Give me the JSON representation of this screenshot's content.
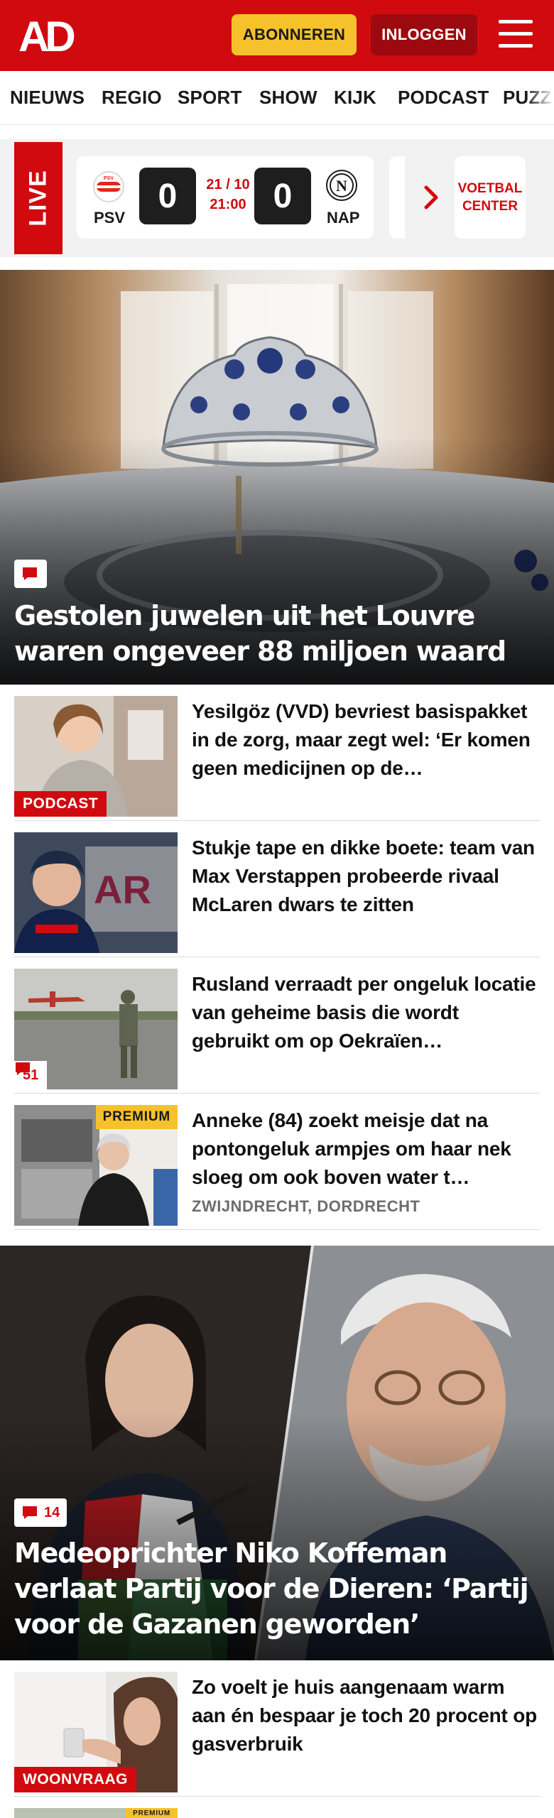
{
  "header": {
    "logo_text": "AD",
    "subscribe_label": "ABONNEREN",
    "login_label": "INLOGGEN",
    "brand_color": "#d10a10"
  },
  "nav": {
    "items": [
      "NIEUWS",
      "REGIO",
      "SPORT",
      "SHOW",
      "KIJK",
      "PODCAST",
      "PUZZ"
    ]
  },
  "live": {
    "label": "LIVE",
    "match": {
      "home": "PSV",
      "away": "NAP",
      "home_score": "0",
      "away_score": "0",
      "date": "21 / 10",
      "time": "21:00"
    },
    "voetbal_line1": "VOETBAL",
    "voetbal_line2": "CENTER"
  },
  "hero1": {
    "title": "Gestolen juwelen uit het Louvre waren ongeveer 88 miljoen waard",
    "icon": "comment-icon"
  },
  "articles": [
    {
      "title": "Yesilgöz (VVD) bevriest basispak­ket in de zorg, maar zegt wel: ‘Er komen geen medicijnen op de…",
      "label": "PODCAST"
    },
    {
      "title": "Stukje tape en dikke boete: team van Max Verstappen probeerde rivaal McLaren dwars te zitten"
    },
    {
      "title": "Rusland verraadt per ongeluk locatie van geheime basis die wordt gebruikt om op Oekraïen…",
      "comments": "51"
    },
    {
      "title": "Anneke (84) zoekt meisje dat na pontongeluk armpjes om haar nek sloeg om ook boven water t…",
      "badge": "PREMIUM",
      "meta": "ZWIJNDRECHT, DORDRECHT"
    }
  ],
  "hero2": {
    "title": "Medeoprichter Niko Koffeman verlaat Partij voor de Dieren: ‘Partij voor de Gazanen geworden’",
    "comments": "14"
  },
  "article5": {
    "title": "Zo voelt je huis aangenaam warm aan én bespaar je toch 20 procent op gasverbruik",
    "label": "WOONVRAAG"
  },
  "article6": {
    "badge": "PREMIUM"
  }
}
